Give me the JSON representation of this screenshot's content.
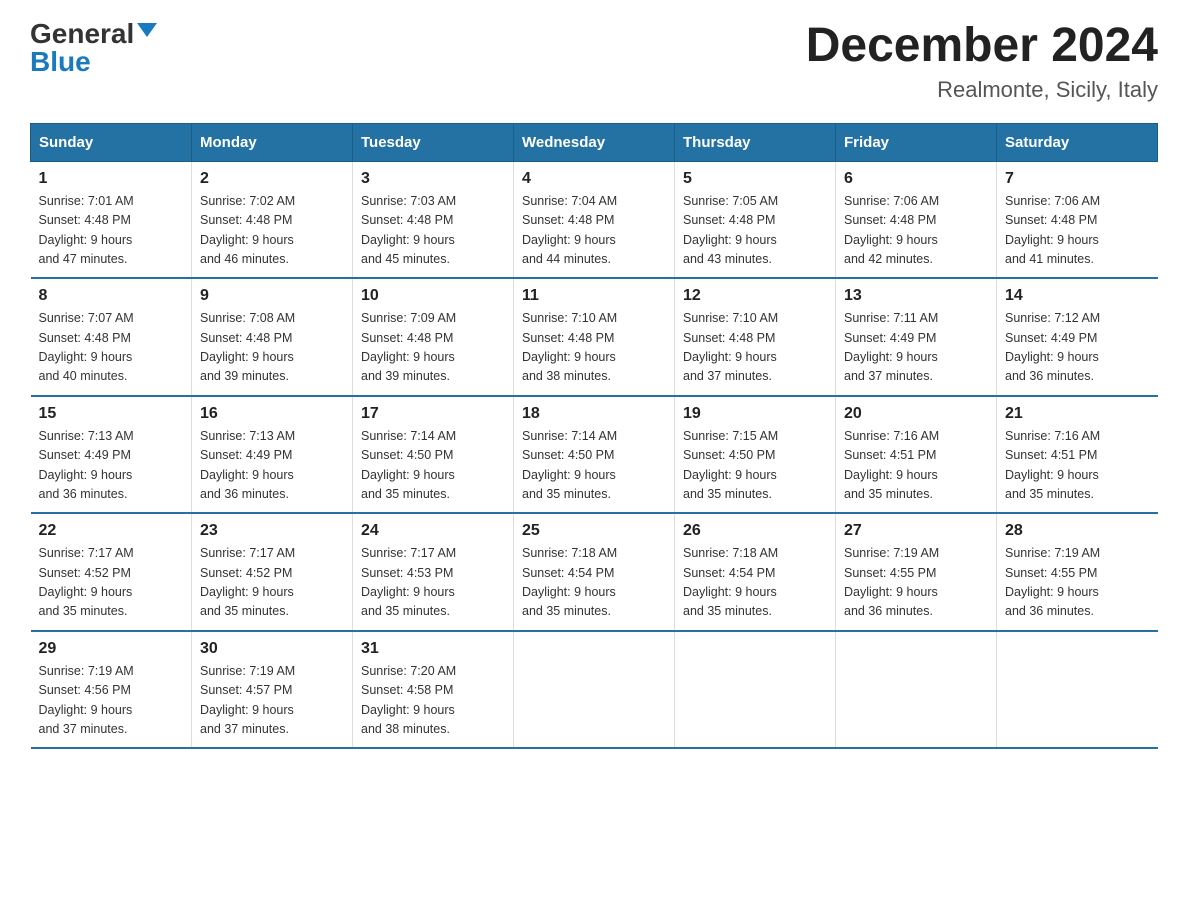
{
  "header": {
    "logo_general": "General",
    "logo_blue": "Blue",
    "month_title": "December 2024",
    "location": "Realmonte, Sicily, Italy"
  },
  "days_of_week": [
    "Sunday",
    "Monday",
    "Tuesday",
    "Wednesday",
    "Thursday",
    "Friday",
    "Saturday"
  ],
  "weeks": [
    [
      {
        "day": "1",
        "sunrise": "7:01 AM",
        "sunset": "4:48 PM",
        "daylight": "9 hours and 47 minutes."
      },
      {
        "day": "2",
        "sunrise": "7:02 AM",
        "sunset": "4:48 PM",
        "daylight": "9 hours and 46 minutes."
      },
      {
        "day": "3",
        "sunrise": "7:03 AM",
        "sunset": "4:48 PM",
        "daylight": "9 hours and 45 minutes."
      },
      {
        "day": "4",
        "sunrise": "7:04 AM",
        "sunset": "4:48 PM",
        "daylight": "9 hours and 44 minutes."
      },
      {
        "day": "5",
        "sunrise": "7:05 AM",
        "sunset": "4:48 PM",
        "daylight": "9 hours and 43 minutes."
      },
      {
        "day": "6",
        "sunrise": "7:06 AM",
        "sunset": "4:48 PM",
        "daylight": "9 hours and 42 minutes."
      },
      {
        "day": "7",
        "sunrise": "7:06 AM",
        "sunset": "4:48 PM",
        "daylight": "9 hours and 41 minutes."
      }
    ],
    [
      {
        "day": "8",
        "sunrise": "7:07 AM",
        "sunset": "4:48 PM",
        "daylight": "9 hours and 40 minutes."
      },
      {
        "day": "9",
        "sunrise": "7:08 AM",
        "sunset": "4:48 PM",
        "daylight": "9 hours and 39 minutes."
      },
      {
        "day": "10",
        "sunrise": "7:09 AM",
        "sunset": "4:48 PM",
        "daylight": "9 hours and 39 minutes."
      },
      {
        "day": "11",
        "sunrise": "7:10 AM",
        "sunset": "4:48 PM",
        "daylight": "9 hours and 38 minutes."
      },
      {
        "day": "12",
        "sunrise": "7:10 AM",
        "sunset": "4:48 PM",
        "daylight": "9 hours and 37 minutes."
      },
      {
        "day": "13",
        "sunrise": "7:11 AM",
        "sunset": "4:49 PM",
        "daylight": "9 hours and 37 minutes."
      },
      {
        "day": "14",
        "sunrise": "7:12 AM",
        "sunset": "4:49 PM",
        "daylight": "9 hours and 36 minutes."
      }
    ],
    [
      {
        "day": "15",
        "sunrise": "7:13 AM",
        "sunset": "4:49 PM",
        "daylight": "9 hours and 36 minutes."
      },
      {
        "day": "16",
        "sunrise": "7:13 AM",
        "sunset": "4:49 PM",
        "daylight": "9 hours and 36 minutes."
      },
      {
        "day": "17",
        "sunrise": "7:14 AM",
        "sunset": "4:50 PM",
        "daylight": "9 hours and 35 minutes."
      },
      {
        "day": "18",
        "sunrise": "7:14 AM",
        "sunset": "4:50 PM",
        "daylight": "9 hours and 35 minutes."
      },
      {
        "day": "19",
        "sunrise": "7:15 AM",
        "sunset": "4:50 PM",
        "daylight": "9 hours and 35 minutes."
      },
      {
        "day": "20",
        "sunrise": "7:16 AM",
        "sunset": "4:51 PM",
        "daylight": "9 hours and 35 minutes."
      },
      {
        "day": "21",
        "sunrise": "7:16 AM",
        "sunset": "4:51 PM",
        "daylight": "9 hours and 35 minutes."
      }
    ],
    [
      {
        "day": "22",
        "sunrise": "7:17 AM",
        "sunset": "4:52 PM",
        "daylight": "9 hours and 35 minutes."
      },
      {
        "day": "23",
        "sunrise": "7:17 AM",
        "sunset": "4:52 PM",
        "daylight": "9 hours and 35 minutes."
      },
      {
        "day": "24",
        "sunrise": "7:17 AM",
        "sunset": "4:53 PM",
        "daylight": "9 hours and 35 minutes."
      },
      {
        "day": "25",
        "sunrise": "7:18 AM",
        "sunset": "4:54 PM",
        "daylight": "9 hours and 35 minutes."
      },
      {
        "day": "26",
        "sunrise": "7:18 AM",
        "sunset": "4:54 PM",
        "daylight": "9 hours and 35 minutes."
      },
      {
        "day": "27",
        "sunrise": "7:19 AM",
        "sunset": "4:55 PM",
        "daylight": "9 hours and 36 minutes."
      },
      {
        "day": "28",
        "sunrise": "7:19 AM",
        "sunset": "4:55 PM",
        "daylight": "9 hours and 36 minutes."
      }
    ],
    [
      {
        "day": "29",
        "sunrise": "7:19 AM",
        "sunset": "4:56 PM",
        "daylight": "9 hours and 37 minutes."
      },
      {
        "day": "30",
        "sunrise": "7:19 AM",
        "sunset": "4:57 PM",
        "daylight": "9 hours and 37 minutes."
      },
      {
        "day": "31",
        "sunrise": "7:20 AM",
        "sunset": "4:58 PM",
        "daylight": "9 hours and 38 minutes."
      },
      null,
      null,
      null,
      null
    ]
  ],
  "labels": {
    "sunrise": "Sunrise:",
    "sunset": "Sunset:",
    "daylight": "Daylight:"
  }
}
